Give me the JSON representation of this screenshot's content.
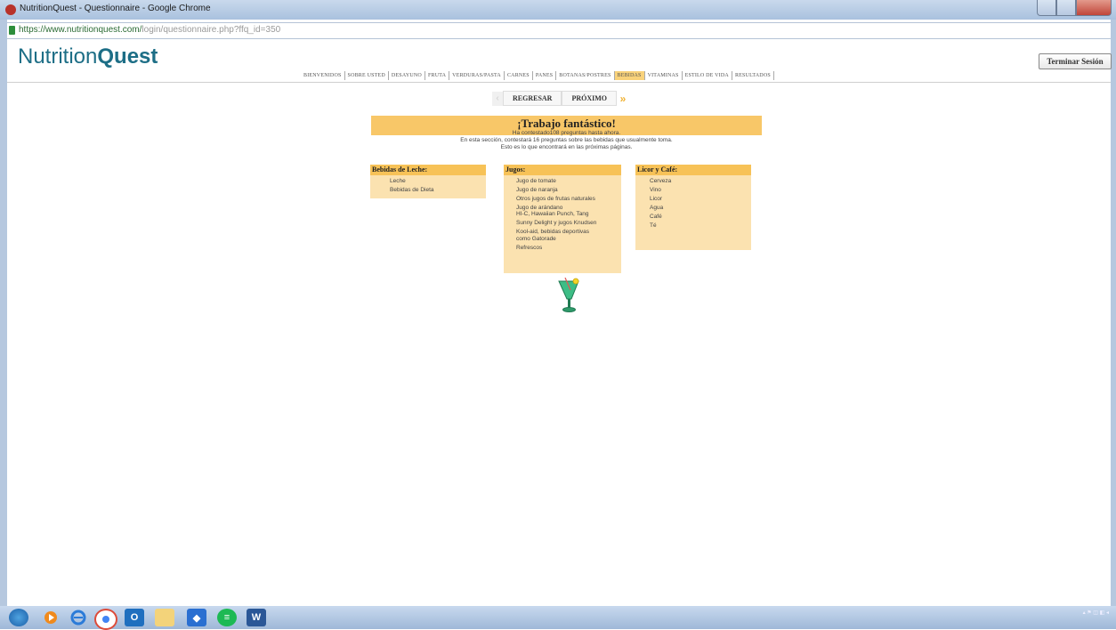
{
  "window": {
    "title": "NutritionQuest - Questionnaire - Google Chrome",
    "url_host": "https://www.nutritionquest.com/",
    "url_path": "login/questionnaire.php?ffq_id=350"
  },
  "header": {
    "logo_plain": "Nutrition",
    "logo_bold": "Quest",
    "logout_label": "Terminar Sesión"
  },
  "nav": {
    "tabs": [
      "BIENVENIDOS",
      "SOBRE USTED",
      "DESAYUNO",
      "FRUTA",
      "VERDURAS/PASTA",
      "CARNES",
      "PANES",
      "BOTANAS/POSTRES",
      "BEBIDAS",
      "VITAMINAS",
      "ESTILO DE VIDA",
      "RESULTADOS"
    ],
    "active_index": 8
  },
  "buttons": {
    "back_label": "REGRESAR",
    "next_label": "PRÓXIMO"
  },
  "banner": {
    "title": "¡Trabajo fantástico!",
    "line1": "Ha contestado108 preguntas hasta ahora.",
    "line2": "En esta sección, contestará 16 preguntas sobre las bebidas que usualmente toma.",
    "line3": "Esto es lo que encontrará en las próximas páginas."
  },
  "columns": [
    {
      "title": "Bebidas de Leche:",
      "items": [
        "Leche",
        "Bebidas de Dieta"
      ]
    },
    {
      "title": "Jugos:",
      "items": [
        "Jugo de tomate",
        "Jugo de naranja",
        "Otros jugos de frutas naturales",
        "Jugo de arándano",
        "HI-C, Hawaiian Punch, Tang",
        "Sunny Delight y jugos Knudsen",
        "Kool-aid, bebidas deportivas",
        "como Gatorade",
        "Refrescos"
      ]
    },
    {
      "title": "Licor y Café:",
      "items": [
        "Cerveza",
        "Vino",
        "Licor",
        "Agua",
        "Café",
        "Té"
      ]
    }
  ],
  "colors": {
    "accent": "#f7c257",
    "panel": "#fbe2b0",
    "logo": "#1d6e86"
  },
  "taskbar": {
    "icons": [
      "windows-start",
      "media-player",
      "internet-explorer",
      "chrome",
      "outlook",
      "file-explorer",
      "dropbox",
      "spotify",
      "word"
    ]
  }
}
